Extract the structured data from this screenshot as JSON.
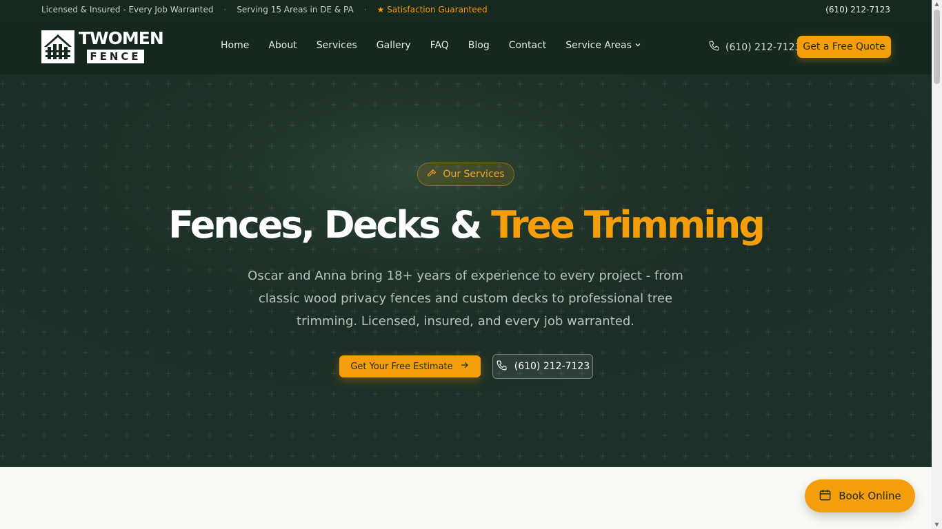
{
  "topbar": {
    "licensed": "Licensed & Insured - Every Job Warranted",
    "serving": "Serving 15 Areas in DE & PA",
    "satisfaction": "★ Satisfaction Guaranteed",
    "phone": "(610) 212-7123",
    "separator": "·"
  },
  "logo": {
    "line1": "TWOMEN",
    "line2": "FENCE"
  },
  "nav": {
    "items": [
      "Home",
      "About",
      "Services",
      "Gallery",
      "FAQ",
      "Blog",
      "Contact",
      "Service Areas"
    ],
    "phone": "(610) 212-7123",
    "quote_button": "Get a Free Quote"
  },
  "hero": {
    "pill_label": "Our Services",
    "title_main": "Fences, Decks & ",
    "title_accent": "Tree Trimming",
    "subtitle": "Oscar and Anna bring 18+ years of experience to every project - from classic wood privacy fences and custom decks to professional tree trimming. Licensed, insured, and every job warranted.",
    "cta_primary": "Get Your Free Estimate",
    "cta_phone": "(610) 212-7123"
  },
  "floating": {
    "book_online": "Book Online"
  },
  "colors": {
    "accent": "#f59e0b",
    "dark": "#16281e",
    "hero_bg": "#1f3329"
  },
  "icons": {
    "phone": "phone-icon",
    "hammer": "hammer-icon",
    "arrow": "arrow-right-icon",
    "calendar": "calendar-icon",
    "chevron": "chevron-down-icon"
  }
}
